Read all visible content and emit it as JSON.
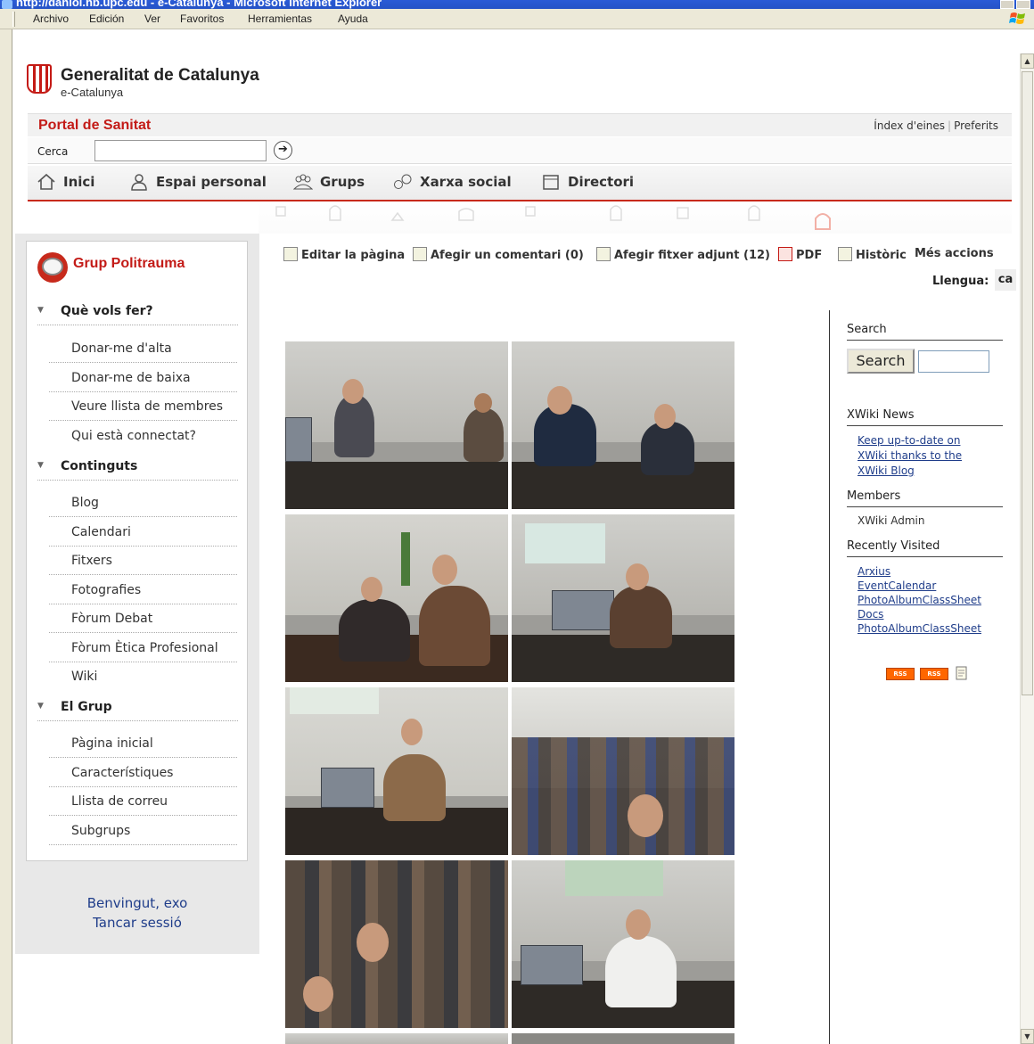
{
  "window": {
    "title": "http://daniol.hb.upc.edu - e-Catalunya - Microsoft Internet Explorer",
    "menu": [
      "Archivo",
      "Edición",
      "Ver",
      "Favoritos",
      "Herramientas",
      "Ayuda"
    ]
  },
  "header": {
    "org_name": "Generalitat de Catalunya",
    "org_sub": "e-Catalunya",
    "portal_title": "Portal de Sanitat",
    "links": [
      "Índex d'eines",
      "Preferits"
    ],
    "search_label": "Cerca",
    "search_value": ""
  },
  "nav": [
    "Inici",
    "Espai personal",
    "Grups",
    "Xarxa social",
    "Directori"
  ],
  "sidebar": {
    "group_title": "Grup Politrauma",
    "sections": [
      {
        "title": "Què vols fer?",
        "items": [
          "Donar-me d'alta",
          "Donar-me de baixa",
          "Veure llista de membres",
          "Qui està connectat?"
        ]
      },
      {
        "title": "Continguts",
        "items": [
          "Blog",
          "Calendari",
          "Fitxers",
          "Fotografies",
          "Fòrum Debat",
          "Fòrum Ètica Profesional",
          "Wiki"
        ]
      },
      {
        "title": "El Grup",
        "items": [
          "Pàgina inicial",
          "Característiques",
          "Llista de correu",
          "Subgrups"
        ]
      }
    ],
    "welcome": "Benvingut, exo",
    "logout": "Tancar sessió"
  },
  "toolbar": {
    "edit": "Editar la pàgina",
    "comment": "Afegir un comentari (0)",
    "attach": "Afegir fitxer adjunt (12)",
    "pdf": "PDF",
    "history": "Històric",
    "more": "Més accions",
    "language_label": "Llengua:",
    "language_value": "ca"
  },
  "right_panel": {
    "search_heading": "Search",
    "search_button": "Search",
    "search_value": "",
    "news_heading": "XWiki News",
    "news_lines": [
      "Keep up-to-date on",
      "XWiki thanks to the",
      "XWiki Blog"
    ],
    "members_heading": "Members",
    "members": [
      "XWiki Admin"
    ],
    "recent_heading": "Recently Visited",
    "recent": [
      "Arxius",
      "EventCalendar",
      "PhotoAlbumClassSheet",
      "Docs",
      "PhotoAlbumClassSheet"
    ],
    "rss_labels": [
      "RSS",
      "RSS"
    ]
  },
  "colors": {
    "brand_red": "#c31b17",
    "link_blue": "#1f3d8a",
    "titlebar_blue": "#2a5bd7"
  }
}
